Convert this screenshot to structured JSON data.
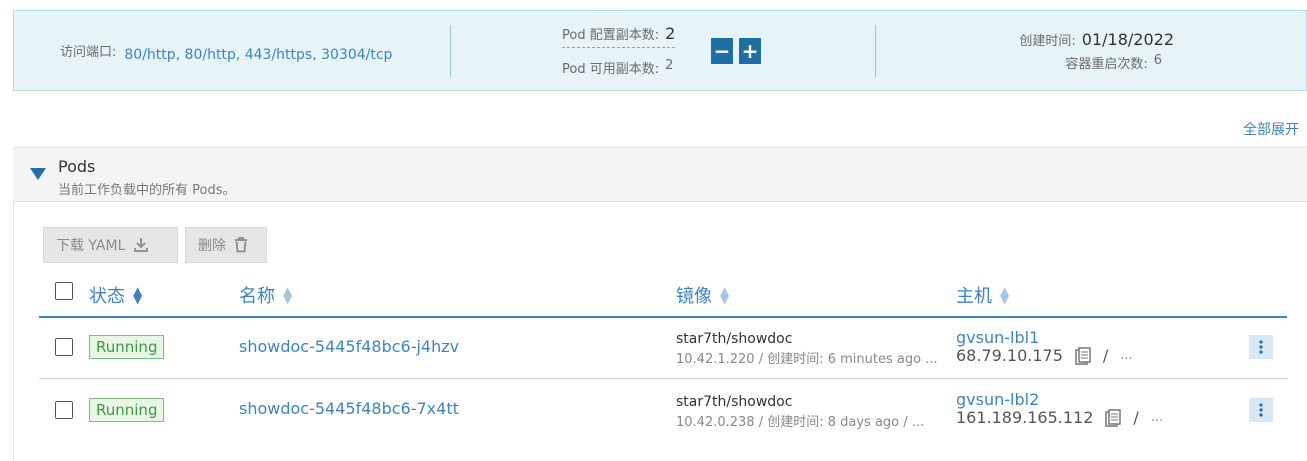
{
  "info": {
    "ports_label": "访问端口:",
    "ports_value": "80/http, 80/http, 443/https, 30304/tcp",
    "replicas_label": "Pod 配置副本数:",
    "replicas_value": "2",
    "available_label": "Pod 可用副本数:",
    "available_value": "2",
    "minus": "−",
    "plus": "+",
    "created_label": "创建时间:",
    "created_value": "01/18/2022",
    "restarts_label": "容器重启次数:",
    "restarts_value": "6"
  },
  "expand_all": "全部展开",
  "pods": {
    "title": "Pods",
    "subtitle": "当前工作负载中的所有 Pods。",
    "download_yaml": "下载 YAML",
    "delete": "删除"
  },
  "columns": {
    "status": "状态",
    "name": "名称",
    "image": "镜像",
    "host": "主机"
  },
  "rows": [
    {
      "status": "Running",
      "name": "showdoc-5445f48bc6-j4hzv",
      "image": "star7th/showdoc",
      "image_sub": "10.42.1.220 / 创建时间: 6 minutes ago ...",
      "host": "gvsun-lbl1",
      "ip": "68.79.10.175",
      "ip_extra": "..."
    },
    {
      "status": "Running",
      "name": "showdoc-5445f48bc6-7x4tt",
      "image": "star7th/showdoc",
      "image_sub": "10.42.0.238 / 创建时间: 8 days ago / ...",
      "host": "gvsun-lbl2",
      "ip": "161.189.165.112",
      "ip_extra": "..."
    }
  ]
}
